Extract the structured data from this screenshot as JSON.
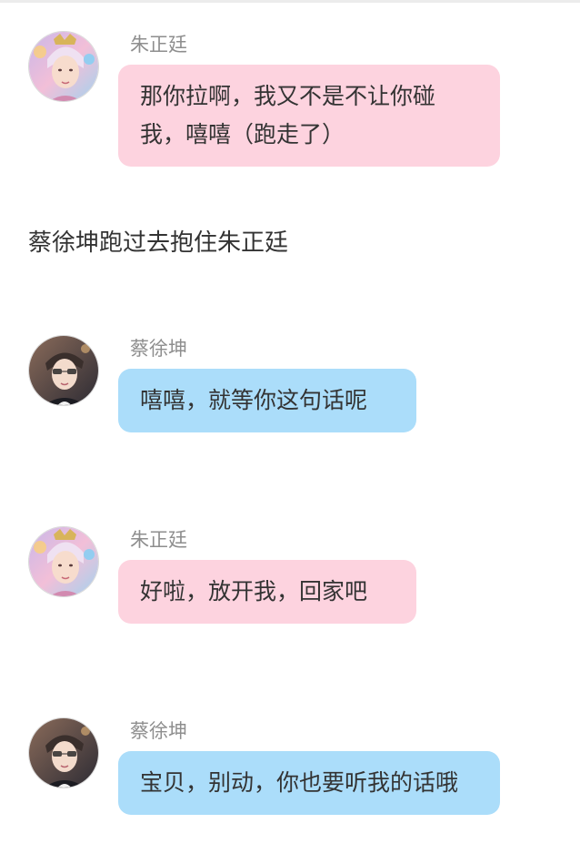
{
  "colors": {
    "pink_bubble": "#fdd3df",
    "blue_bubble": "#abddfa",
    "sender_name": "#8e8e8e",
    "text": "#333333"
  },
  "messages": [
    {
      "sender": "朱正廷",
      "text": "那你拉啊，我又不是不让你碰我，嘻嘻（跑走了）",
      "bubble_color": "pink",
      "avatar": "avatar-zhu-icon"
    },
    {
      "sender": "蔡徐坤",
      "text": "嘻嘻，就等你这句话呢",
      "bubble_color": "blue",
      "avatar": "avatar-cai-icon"
    },
    {
      "sender": "朱正廷",
      "text": "好啦，放开我，回家吧",
      "bubble_color": "pink",
      "avatar": "avatar-zhu-icon"
    },
    {
      "sender": "蔡徐坤",
      "text": "宝贝，别动，你也要听我的话哦",
      "bubble_color": "blue",
      "avatar": "avatar-cai-icon"
    }
  ],
  "narration": "蔡徐坤跑过去抱住朱正廷"
}
